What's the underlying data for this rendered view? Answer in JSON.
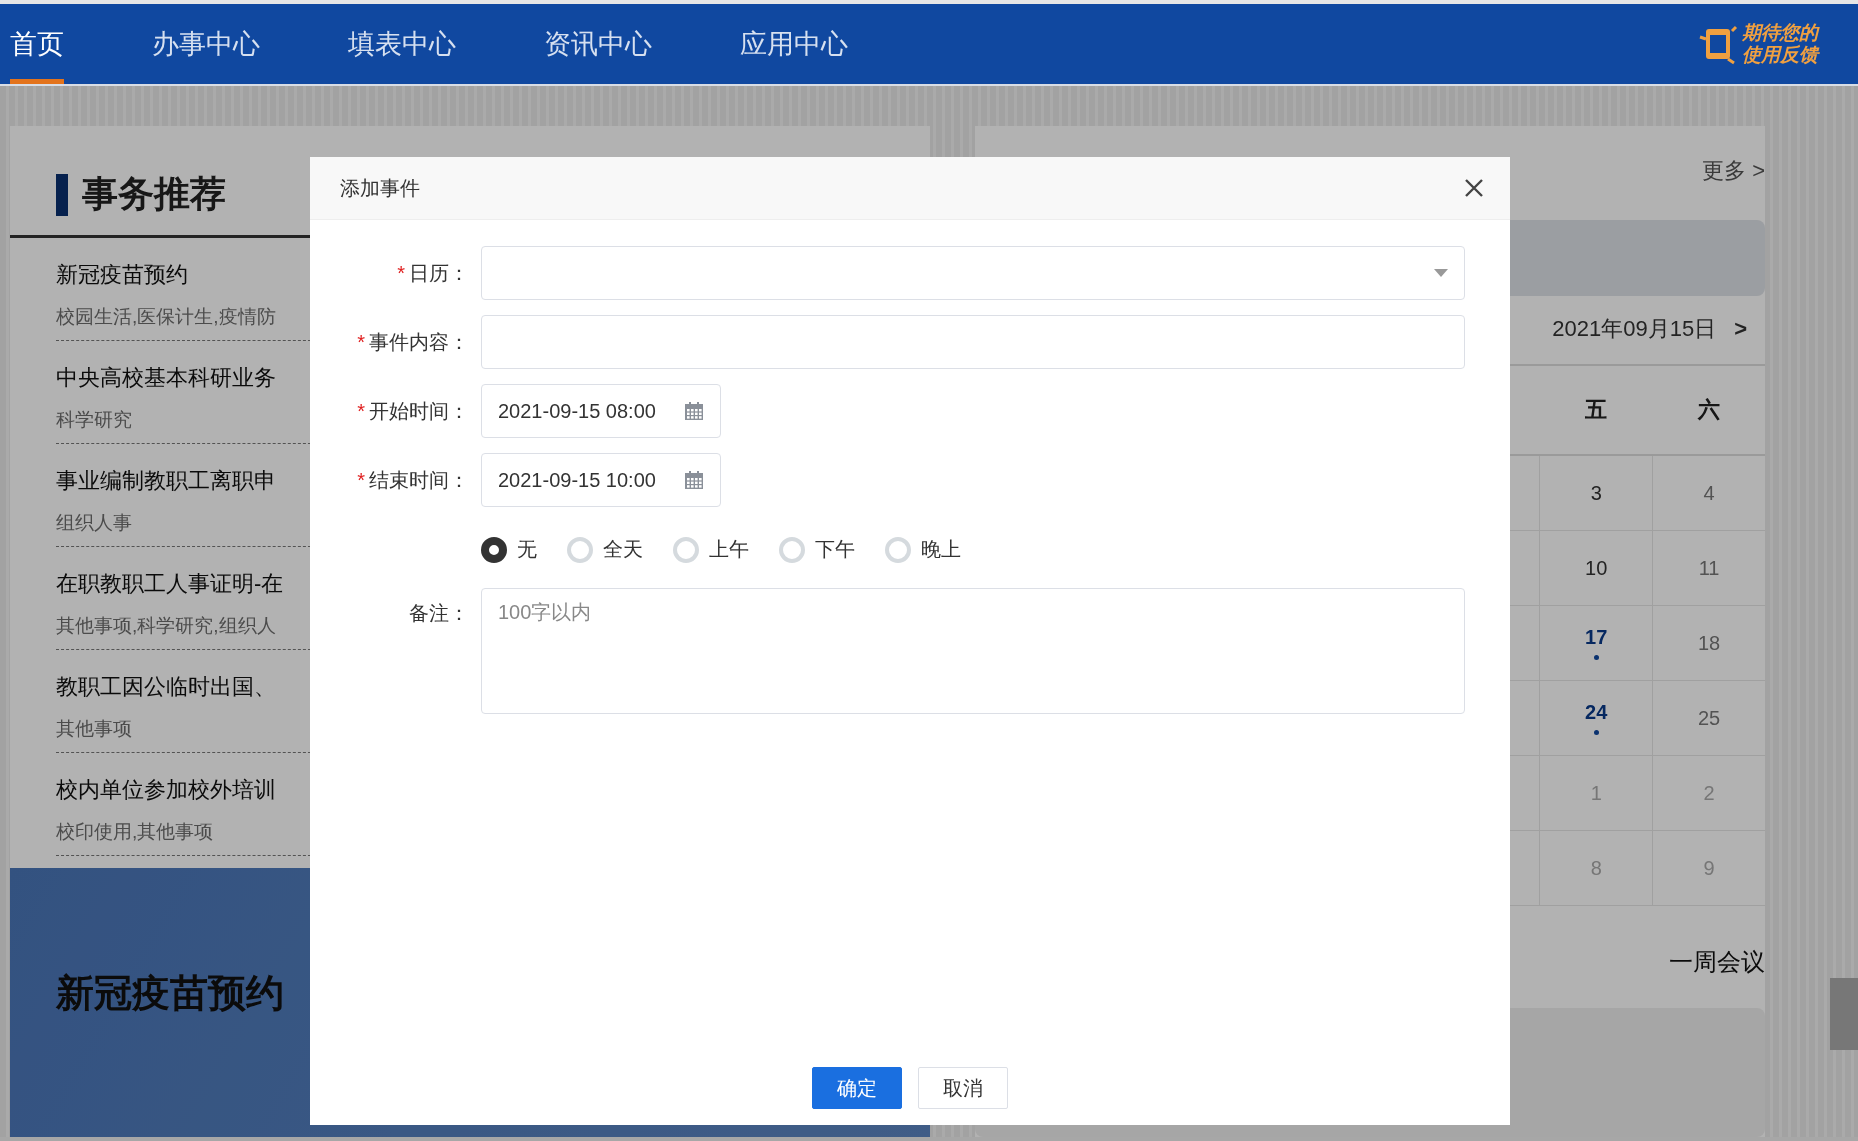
{
  "nav": {
    "items": [
      {
        "label": "首页",
        "selected": true
      },
      {
        "label": "办事中心",
        "selected": false
      },
      {
        "label": "填表中心",
        "selected": false
      },
      {
        "label": "资讯中心",
        "selected": false
      },
      {
        "label": "应用中心",
        "selected": false
      }
    ],
    "logo": {
      "line1": "期待您的",
      "line2": "使用反馈"
    }
  },
  "recommend": {
    "title": "事务推荐",
    "items": [
      {
        "title": "新冠疫苗预约",
        "tags": "校园生活,医保计生,疫情防"
      },
      {
        "title": "中央高校基本科研业务",
        "tags": "科学研究"
      },
      {
        "title": "事业编制教职工离职申",
        "tags": "组织人事"
      },
      {
        "title": "在职教职工人事证明-在",
        "tags": "其他事项,科学研究,组织人"
      },
      {
        "title": "教职工因公临时出国、",
        "tags": "其他事项"
      },
      {
        "title": "校内单位参加校外培训",
        "tags": "校印使用,其他事项"
      }
    ],
    "banner": {
      "title": "新冠疫苗预约"
    }
  },
  "calendar": {
    "more": "更多 >",
    "date": "2021年09月15日",
    "next": ">",
    "weekdays": [
      "五",
      "六"
    ],
    "weeks": [
      [
        {
          "day": "3",
          "event": false,
          "other_month": false
        },
        {
          "day": "4",
          "event": false,
          "other_month": false
        }
      ],
      [
        {
          "day": "10",
          "event": false,
          "other_month": false
        },
        {
          "day": "11",
          "event": false,
          "other_month": false
        }
      ],
      [
        {
          "day": "17",
          "event": true,
          "other_month": false
        },
        {
          "day": "18",
          "event": false,
          "other_month": false
        }
      ],
      [
        {
          "day": "24",
          "event": true,
          "other_month": false
        },
        {
          "day": "25",
          "event": false,
          "other_month": false
        }
      ],
      [
        {
          "day": "1",
          "event": false,
          "other_month": true
        },
        {
          "day": "2",
          "event": false,
          "other_month": true
        }
      ],
      [
        {
          "day": "8",
          "event": false,
          "other_month": true
        },
        {
          "day": "9",
          "event": false,
          "other_month": true
        }
      ]
    ],
    "meetings": "一周会议"
  },
  "dialog": {
    "title": "添加事件",
    "fields": [
      {
        "kind": "select",
        "label": "日历：",
        "required_mark": "*"
      },
      {
        "kind": "text",
        "label": "事件内容：",
        "required_mark": "*"
      },
      {
        "kind": "date",
        "label": "开始时间：",
        "required_mark": "*",
        "value": "2021-09-15 08:00"
      },
      {
        "kind": "date",
        "label": "结束时间：",
        "required_mark": "*",
        "value": "2021-09-15 10:00"
      },
      {
        "kind": "radio",
        "options": [
          {
            "label": "无",
            "selected": true
          },
          {
            "label": "全天",
            "selected": false
          },
          {
            "label": "上午",
            "selected": false
          },
          {
            "label": "下午",
            "selected": false
          },
          {
            "label": "晚上",
            "selected": false
          }
        ]
      },
      {
        "kind": "textarea",
        "label": "备注：",
        "placeholder": "100字以内"
      }
    ],
    "buttons": [
      {
        "label": "确定",
        "kind": "primary"
      },
      {
        "label": "取消",
        "kind": "default"
      }
    ]
  }
}
